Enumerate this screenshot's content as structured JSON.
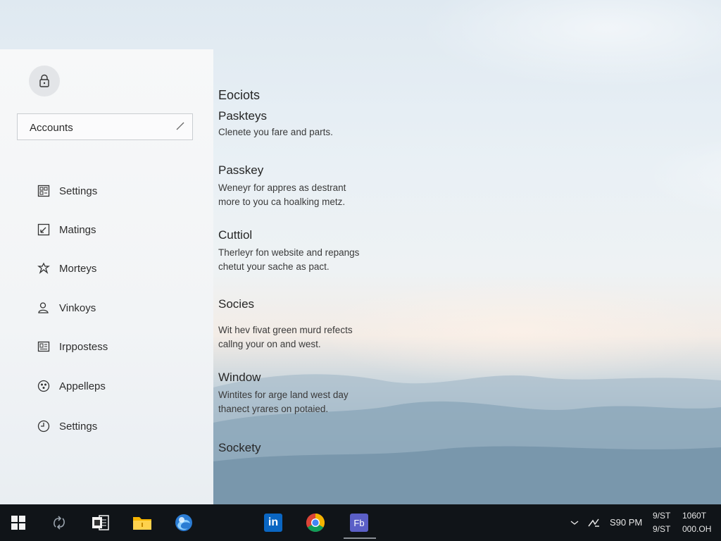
{
  "sidebar": {
    "account_label": "Accounts",
    "items": [
      {
        "label": "Settings",
        "icon": "grid-icon"
      },
      {
        "label": "Matings",
        "icon": "resize-icon"
      },
      {
        "label": "Morteys",
        "icon": "puzzle-icon"
      },
      {
        "label": "Vinkoys",
        "icon": "person-icon"
      },
      {
        "label": "Irppostess",
        "icon": "id-card-icon"
      },
      {
        "label": "Appelleps",
        "icon": "apps-icon"
      },
      {
        "label": "Settings",
        "icon": "clock-icon"
      }
    ]
  },
  "content": {
    "section_title": "Eociots",
    "blocks": [
      {
        "heading": "Paskteys",
        "line1": "Clenete you fare and parts.",
        "line2": ""
      },
      {
        "heading": "Passkey",
        "line1": "Weneyr for appres as destrant",
        "line2": "more to you ca hoalking metz."
      },
      {
        "heading": "Cuttiol",
        "line1": "Therleyr fon website and repangs",
        "line2": "chetut your sache as pact."
      },
      {
        "heading": "Socies",
        "line1": "Wit hev fivat green murd refects",
        "line2": "callng your on and west."
      },
      {
        "heading": "Window",
        "line1": "Wintites for arge land west day",
        "line2": "thanect yrares on potaied."
      },
      {
        "heading": "Sockety",
        "line1": "",
        "line2": ""
      }
    ]
  },
  "taskbar": {
    "apps": [
      "start-icon",
      "sync-icon",
      "office-icon",
      "folder-icon",
      "edge-icon",
      "linkedin-icon",
      "chrome-icon",
      "teams-icon"
    ],
    "linkedin_label": "in",
    "teams_label": "Fb",
    "tray": {
      "time_left": "S90 PM",
      "col2_top": "9/ST",
      "col2_bottom": "9/ST",
      "col3_top": "1060T",
      "col3_bottom": "000.OH"
    }
  },
  "colors": {
    "taskbar": "#101418",
    "linkedin": "#0a66c2",
    "teams": "#5b5fc7",
    "folder": "#f5b400",
    "edge": "#2b7cd3"
  }
}
